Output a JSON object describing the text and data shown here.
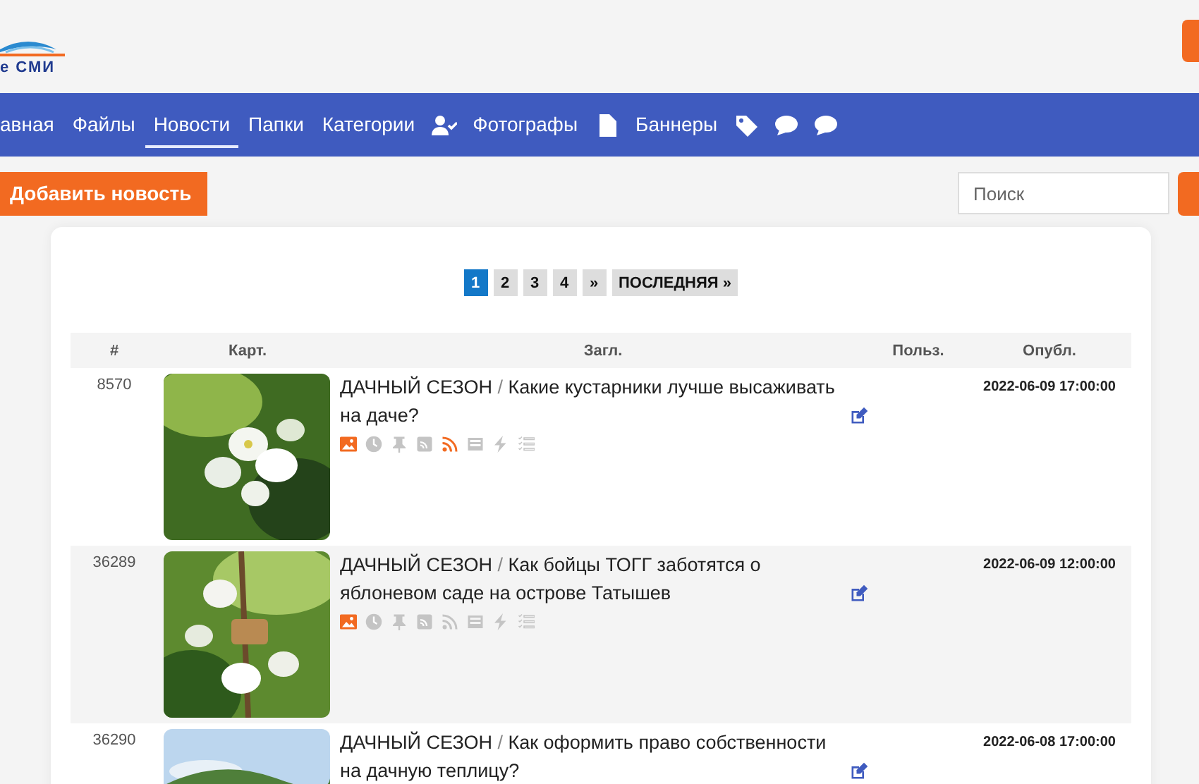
{
  "logo": {
    "text": "е СМИ"
  },
  "nav": [
    {
      "kind": "link",
      "label": "авная",
      "selected": false
    },
    {
      "kind": "link",
      "label": "Файлы",
      "selected": false
    },
    {
      "kind": "link",
      "label": "Новости",
      "selected": true
    },
    {
      "kind": "link",
      "label": "Папки",
      "selected": false
    },
    {
      "kind": "link",
      "label": "Категории",
      "selected": false
    },
    {
      "kind": "icon"
    },
    {
      "kind": "link",
      "label": "Фотографы",
      "selected": false
    },
    {
      "kind": "icon"
    },
    {
      "kind": "link",
      "label": "Баннеры",
      "selected": false
    },
    {
      "kind": "icon"
    },
    {
      "kind": "icon"
    },
    {
      "kind": "icon"
    }
  ],
  "add_button": "Добавить новость",
  "search": {
    "placeholder": "Поиск"
  },
  "pagination": [
    {
      "label": "1",
      "selected": true
    },
    {
      "label": "2",
      "selected": false
    },
    {
      "label": "3",
      "selected": false
    },
    {
      "label": "4",
      "selected": false
    },
    {
      "label": "»",
      "selected": false
    },
    {
      "label": "ПОСЛЕДНЯЯ »",
      "selected": false
    }
  ],
  "table": {
    "columns": [
      "#",
      "Карт.",
      "Загл.",
      "Польз.",
      "Опубл."
    ],
    "rows": [
      {
        "id": "8570",
        "category": "ДАЧНЫЙ СЕЗОН",
        "separator": "/",
        "title": "Какие кустарники лучше высаживать на даче?",
        "published": "2022-06-09 17:00:00",
        "flags": [
          {
            "on": true
          },
          {
            "on": false
          },
          {
            "on": false
          },
          {
            "on": false
          },
          {
            "on": true
          },
          {
            "on": false
          },
          {
            "on": false
          },
          {
            "on": false
          }
        ]
      },
      {
        "id": "36289",
        "category": "ДАЧНЫЙ СЕЗОН",
        "separator": "/",
        "title": "Как бойцы ТОГГ заботятся о яблоневом саде на острове Татышев",
        "published": "2022-06-09 12:00:00",
        "flags": [
          {
            "on": true
          },
          {
            "on": false
          },
          {
            "on": false
          },
          {
            "on": false
          },
          {
            "on": false
          },
          {
            "on": false
          },
          {
            "on": false
          },
          {
            "on": false
          }
        ]
      },
      {
        "id": "36290",
        "category": "ДАЧНЫЙ СЕЗОН",
        "separator": "/",
        "title": "Как оформить право собственности на дачную теплицу?",
        "published": "2022-06-08 17:00:00",
        "flags": []
      }
    ]
  }
}
